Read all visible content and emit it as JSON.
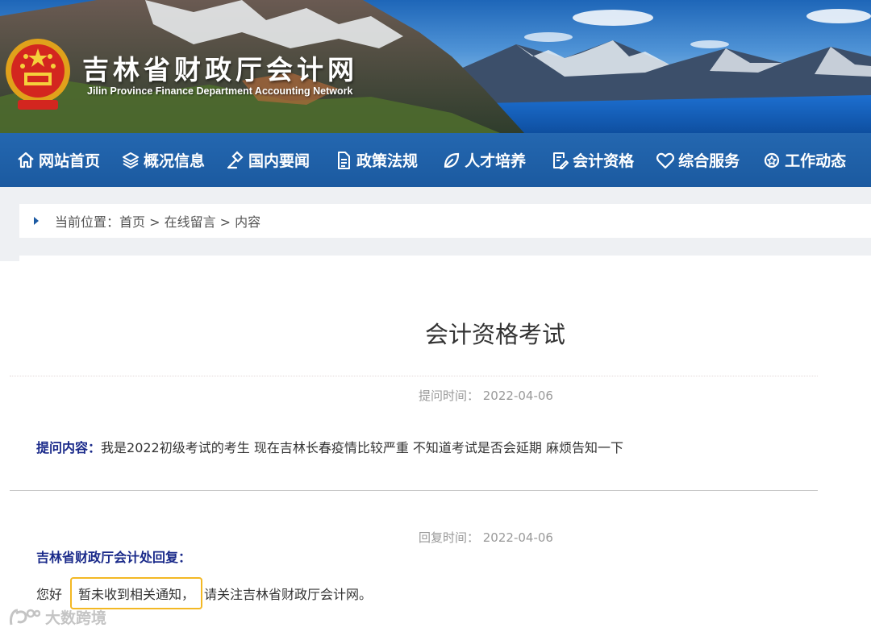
{
  "banner": {
    "title": "吉林省财政厅会计网",
    "subtitle": "Jilin Province Finance Department Accounting Network"
  },
  "nav": {
    "items": [
      {
        "label": "网站首页",
        "icon": "home-icon"
      },
      {
        "label": "概况信息",
        "icon": "layers-icon"
      },
      {
        "label": "国内要闻",
        "icon": "gavel-icon"
      },
      {
        "label": "政策法规",
        "icon": "document-icon"
      },
      {
        "label": "人才培养",
        "icon": "leaf-icon"
      },
      {
        "label": "会计资格",
        "icon": "edit-document-icon"
      },
      {
        "label": "综合服务",
        "icon": "heart-icon"
      },
      {
        "label": "工作动态",
        "icon": "gear-icon"
      }
    ]
  },
  "breadcrumb": {
    "text": "当前位置：首页 > 在线留言 > 内容"
  },
  "article": {
    "title": "会计资格考试",
    "ask_time": "提问时间： 2022-04-06",
    "ask_label": "提问内容：",
    "ask_text": "我是2022初级考试的考生 现在吉林长春疫情比较严重 不知道考试是否会延期 麻烦告知一下",
    "reply_time": "回复时间： 2022-04-06",
    "reply_head": "吉林省财政厅会计处回复：",
    "reply_greeting": "您好",
    "reply_highlight": "暂未收到相关通知，",
    "reply_rest": "请关注吉林省财政厅会计网。"
  },
  "watermark": {
    "text": "大数跨境"
  },
  "colors": {
    "nav_bg": "#1b5aa0",
    "label_blue": "#1a2a8a",
    "highlight_border": "#f3b824"
  }
}
